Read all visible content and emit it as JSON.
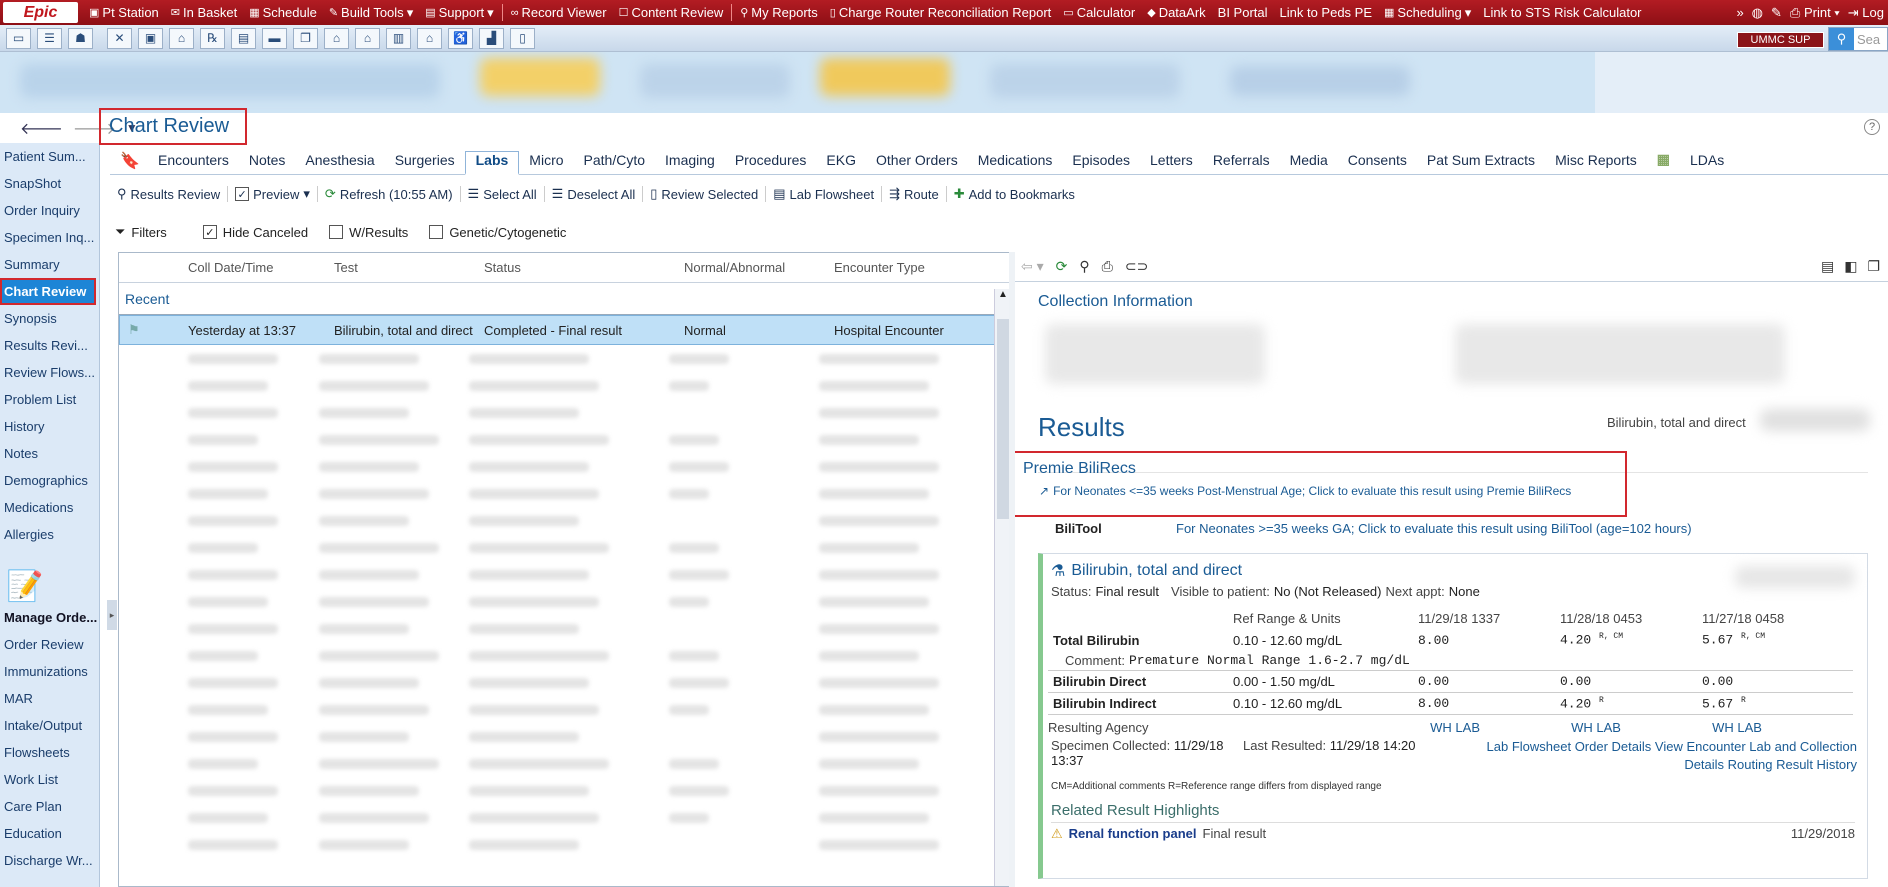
{
  "topbar": {
    "logo": "Epic",
    "items": [
      "Pt Station",
      "In Basket",
      "Schedule",
      "Build Tools",
      "Support",
      "Record Viewer",
      "Content Review",
      "My Reports",
      "Charge Router Reconciliation Report",
      "Calculator",
      "DataArk",
      "BI Portal",
      "Link to Peds PE",
      "Scheduling",
      "Link to STS Risk Calculator"
    ],
    "right": [
      "Print",
      "Log"
    ]
  },
  "iconrow": {
    "badge": "UMMC SUP",
    "search_placeholder": "Sea"
  },
  "nav": {
    "items": [
      "Patient Sum...",
      "SnapShot",
      "Order Inquiry",
      "Specimen Inq...",
      "Summary",
      "Chart Review",
      "Synopsis",
      "Results Revi...",
      "Review Flows...",
      "Problem List",
      "History",
      "Notes",
      "Demographics",
      "Medications",
      "Allergies"
    ],
    "section": "Manage Orde...",
    "items2": [
      "Order Review",
      "Immunizations",
      "MAR",
      "Intake/Output",
      "Flowsheets",
      "Work List",
      "Care Plan",
      "Education",
      "Discharge Wr..."
    ]
  },
  "page": {
    "title": "Chart Review",
    "help": "?"
  },
  "tabs": [
    "Encounters",
    "Notes",
    "Anesthesia",
    "Surgeries",
    "Labs",
    "Micro",
    "Path/Cyto",
    "Imaging",
    "Procedures",
    "EKG",
    "Other Orders",
    "Medications",
    "Episodes",
    "Letters",
    "Referrals",
    "Media",
    "Consents",
    "Pat Sum Extracts",
    "Misc Reports",
    "LDAs"
  ],
  "toolbar": [
    "Results Review",
    "Preview",
    "Refresh (10:55 AM)",
    "Select All",
    "Deselect All",
    "Review Selected",
    "Lab Flowsheet",
    "Route",
    "Add to Bookmarks"
  ],
  "filters": {
    "label": "Filters",
    "hide_canceled": "Hide Canceled",
    "w_results": "W/Results",
    "genetic": "Genetic/Cytogenetic"
  },
  "list": {
    "headers": [
      "Coll Date/Time",
      "Test",
      "Status",
      "Normal/Abnormal",
      "Encounter Type"
    ],
    "group": "Recent",
    "row": {
      "date": "Yesterday at 13:37",
      "test": "Bilirubin, total and direct",
      "status": "Completed - Final result",
      "normal": "Normal",
      "encounter": "Hospital Encounter"
    }
  },
  "detail": {
    "collection_title": "Collection Information",
    "results_title": "Results",
    "results_right": "Bilirubin, total and direct",
    "premie_title": "Premie BiliRecs",
    "premie_link": "For Neonates <=35 weeks Post-Menstrual Age; Click to evaluate this result using Premie BiliRecs",
    "bilitool_label": "BiliTool",
    "bilitool_link": "For Neonates >=35 weeks GA; Click to evaluate this result using BiliTool (age=102 hours)",
    "card": {
      "title": "Bilirubin, total and direct",
      "status_label": "Status:",
      "status_value": "Final result",
      "visible_label": "Visible to patient:",
      "visible_value": "No (Not Released)",
      "next_label": "Next appt:",
      "next_value": "None",
      "col_ref": "Ref Range & Units",
      "cols": [
        "11/29/18 1337",
        "11/28/18 0453",
        "11/27/18 0458"
      ],
      "total_label": "Total Bilirubin",
      "total_ref": "0.10 - 12.60 mg/dL",
      "total_vals": [
        "8.00",
        "4.20",
        "5.67"
      ],
      "total_sup": [
        "",
        "R, CM",
        "R, CM"
      ],
      "comment_label": "Comment:",
      "comment": "Premature Normal Range 1.6-2.7 mg/dL",
      "direct_label": "Bilirubin Direct",
      "direct_ref": "0.00 - 1.50 mg/dL",
      "direct_vals": [
        "0.00",
        "0.00",
        "0.00"
      ],
      "indirect_label": "Bilirubin Indirect",
      "indirect_ref": "0.10 - 12.60 mg/dL",
      "indirect_vals": [
        "8.00",
        "4.20",
        "5.67"
      ],
      "indirect_sup": [
        "",
        "R",
        "R"
      ],
      "agency_label": "Resulting Agency",
      "agency": [
        "WH LAB",
        "WH LAB",
        "WH LAB"
      ],
      "collected_label": "Specimen Collected:",
      "collected_value": "11/29/18",
      "collected_time": "13:37",
      "last_label": "Last Resulted:",
      "last_value": "11/29/18 14:20",
      "links1": "Lab Flowsheet  Order Details  View Encounter  Lab and Collection",
      "links2": "Details  Routing  Result History",
      "legend": "CM=Additional comments   R=Reference range differs from displayed range",
      "related_title": "Related Result Highlights",
      "related_link": "Renal function panel",
      "related_status": "Final result",
      "related_date": "11/29/2018"
    }
  }
}
